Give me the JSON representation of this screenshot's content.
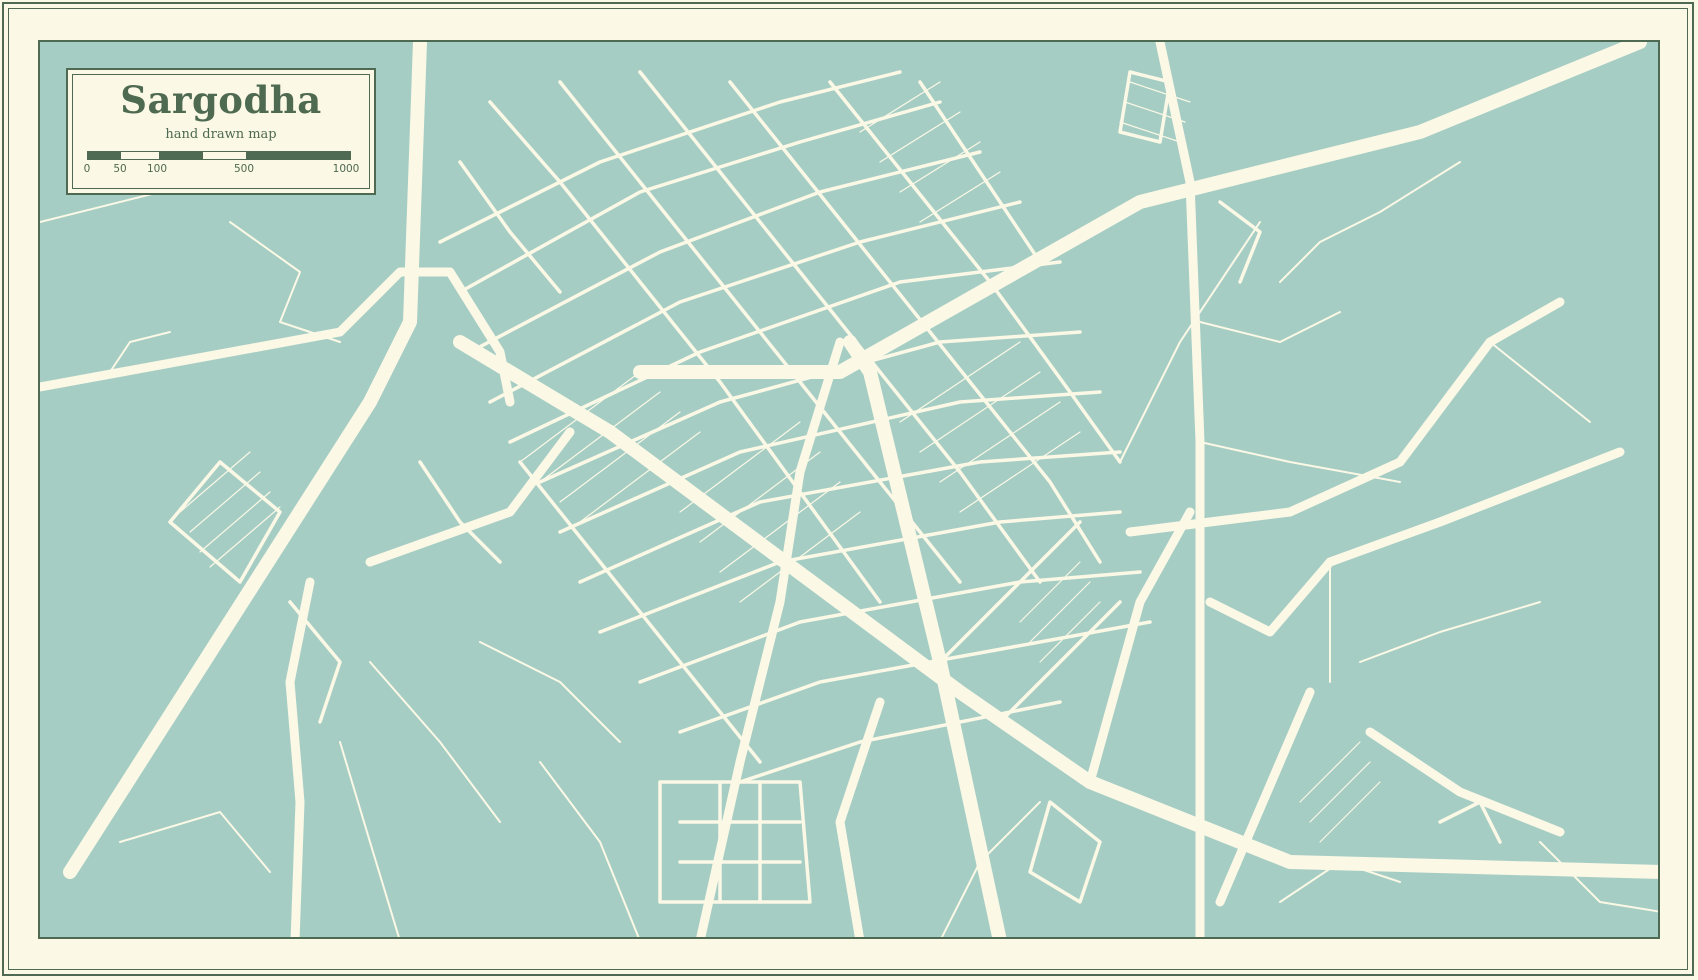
{
  "map": {
    "city": "Sargodha",
    "subtitle": "hand drawn map",
    "scale": {
      "ticks": [
        "0",
        "50",
        "100",
        "500",
        "1000"
      ]
    }
  },
  "colors": {
    "water_land": "#a6cdc4",
    "roads": "#fbf8e6",
    "frame": "#4f6a52",
    "text": "#4e6a50"
  }
}
